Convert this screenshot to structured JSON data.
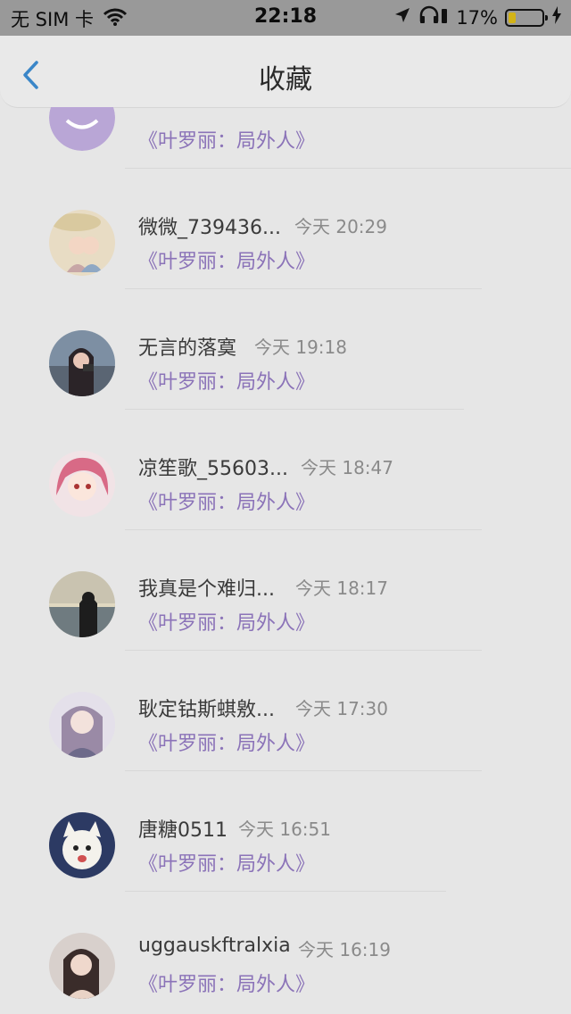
{
  "status_bar": {
    "carrier": "无 SIM 卡",
    "time": "22:18",
    "battery": "17%"
  },
  "nav": {
    "title": "收藏"
  },
  "book_title": "《叶罗丽：局外人》",
  "items": [
    {
      "name": "微微_739436...",
      "time": "今天 20:29"
    },
    {
      "name": "无言的落寞",
      "time": "今天 19:18"
    },
    {
      "name": "凉笙歌_55603...",
      "time": "今天 18:47"
    },
    {
      "name": "我真是个难归...",
      "time": "今天 18:17"
    },
    {
      "name": "耿定钴斯蜞敫...",
      "time": "今天 17:30"
    },
    {
      "name": "唐糖0511",
      "time": "今天 16:51"
    },
    {
      "name": "uggauskftralxia",
      "time": "今天 16:19"
    }
  ],
  "colors": {
    "accent": "#3a86c8",
    "book_link": "#8b73b8",
    "battery": "#d3b316"
  }
}
